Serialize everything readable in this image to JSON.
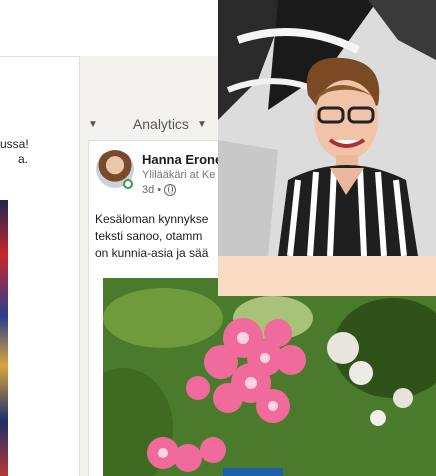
{
  "left_card": {
    "line1": "ussa!",
    "line2": "a."
  },
  "filter_bar": {
    "label": "Analytics"
  },
  "post": {
    "author": "Hanna Erone",
    "headline": "Ylilääkäri at Ke",
    "time": "3d •",
    "text_lines": [
      "Kesäloman kynnykse",
      "teksti sanoo, otamm",
      "on kunnia-asia ja sää"
    ]
  },
  "colors": {
    "page_bg": "#f3f2ef",
    "card_bg": "#ffffff",
    "overlay_peach": "#f9dcc1",
    "online_green": "#3a9b4b",
    "flower_pink": "#f06a9c"
  }
}
